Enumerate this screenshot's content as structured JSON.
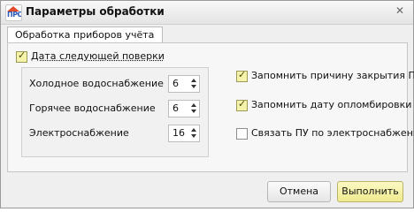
{
  "window": {
    "title": "Параметры обработки",
    "close_glyph": "✕",
    "icon_text": "ПРО"
  },
  "tabs": [
    {
      "label": "Обработка приборов учёта",
      "active": true
    }
  ],
  "options": {
    "next_check_date": {
      "label": "Дата следующей поверки",
      "checked": true
    },
    "fields": [
      {
        "label": "Холодное водоснабжение",
        "value": "6"
      },
      {
        "label": "Горячее водоснабжение",
        "value": "6"
      },
      {
        "label": "Электроснабжение",
        "value": "16"
      }
    ],
    "remember_close_reason": {
      "label": "Запомнить причину закрытия ПУ",
      "checked": true
    },
    "remember_seal_date": {
      "label": "Запомнить дату опломбировки",
      "checked": true
    },
    "link_by_electricity": {
      "label": "Связать ПУ по электроснабжению",
      "checked": false
    }
  },
  "buttons": {
    "cancel": "Отмена",
    "ok": "Выполнить"
  },
  "colors": {
    "accent_button": "#f0ea8e",
    "checkbox_fill": "#f5f2a9"
  }
}
